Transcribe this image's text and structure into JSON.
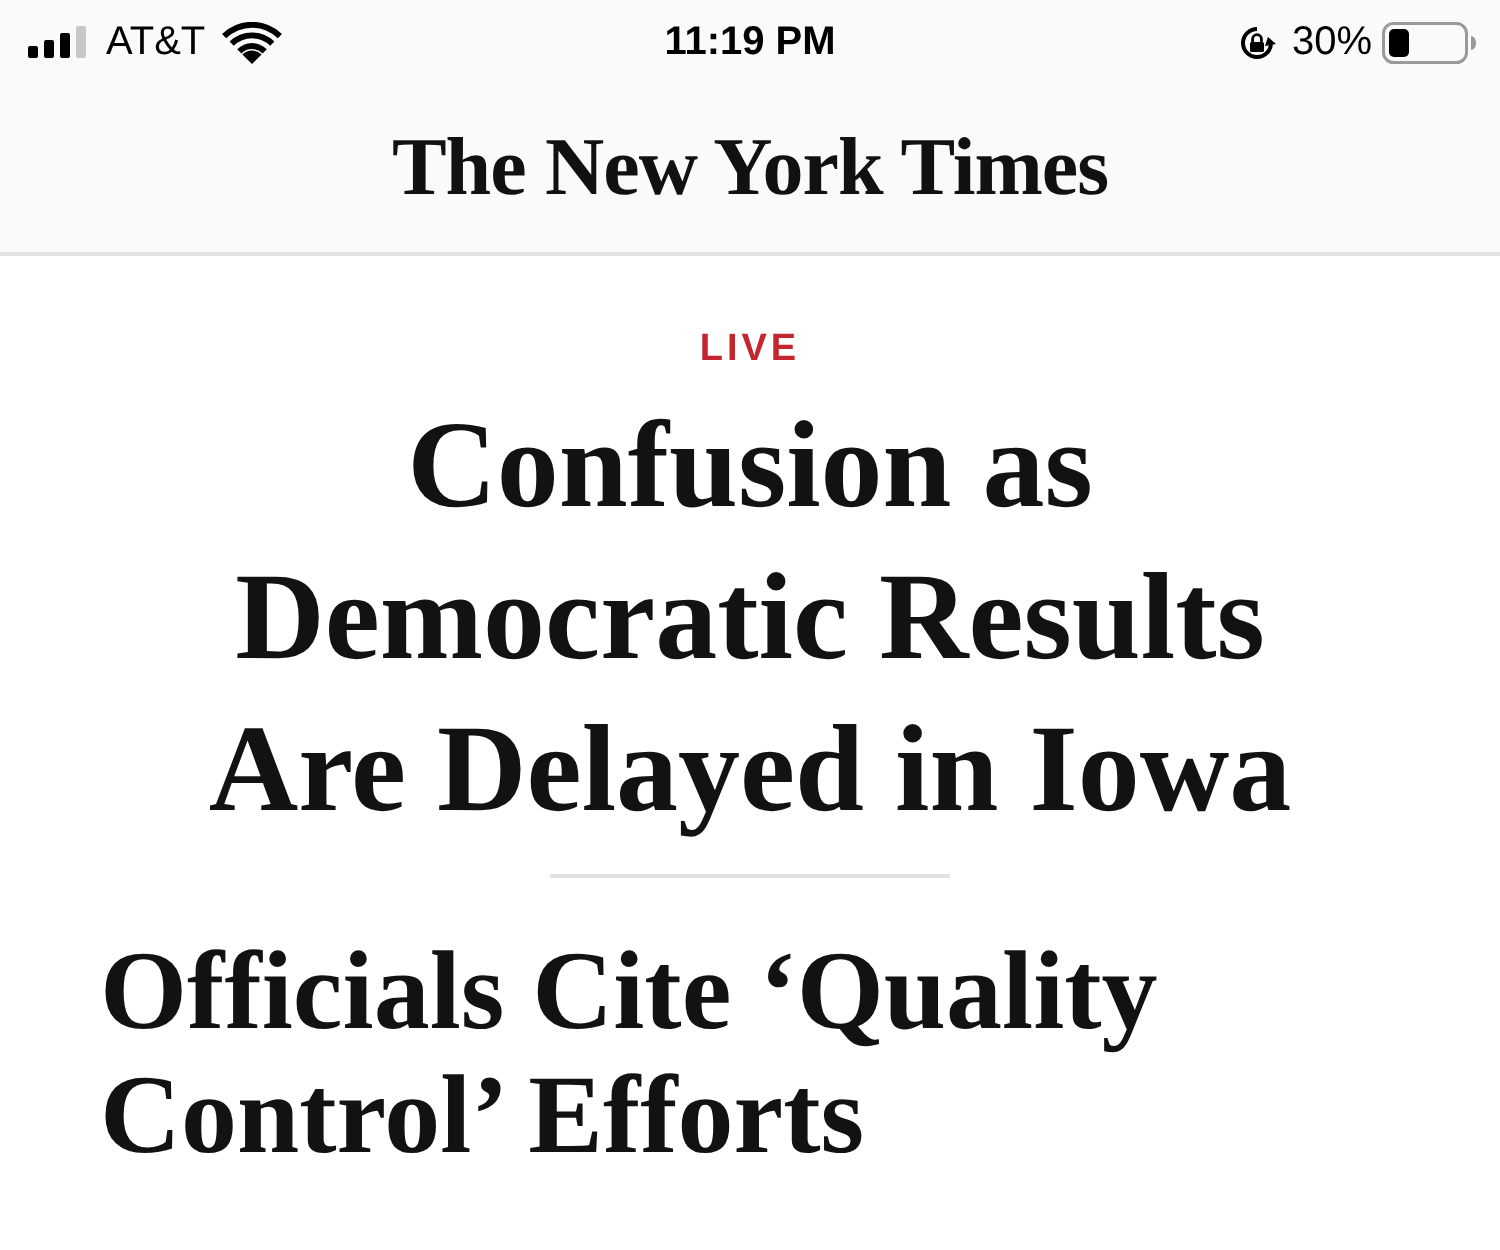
{
  "status_bar": {
    "carrier": "AT&T",
    "time": "11:19 PM",
    "battery_percent": "30%"
  },
  "header": {
    "logo": "The New York Times"
  },
  "article": {
    "label": "LIVE",
    "headline": "Confusion as Democratic Results Are Delayed in Iowa",
    "subheadline": "Officials Cite ‘Quality Control’ Efforts"
  }
}
